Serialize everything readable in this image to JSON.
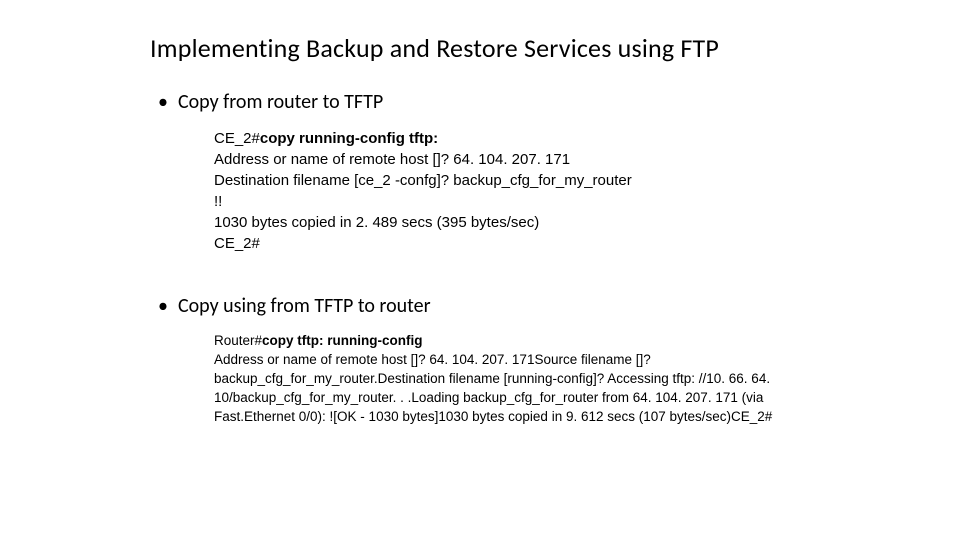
{
  "title": "Implementing Backup and Restore Services using FTP",
  "section1": {
    "heading": "Copy from router to  TFTP",
    "cmd_prefix": "CE_2#",
    "cmd": "copy running-config tftp:",
    "line2": "Address or name of remote host []? 64. 104. 207. 171",
    "line3": "Destination filename [ce_2 -confg]? backup_cfg_for_my_router",
    "line4": "!!",
    "line5": "1030 bytes copied in 2. 489 secs (395 bytes/sec)",
    "line6": "CE_2#"
  },
  "section2": {
    "heading": "Copy using from  TFTP to router",
    "cmd_prefix": "Router#",
    "cmd": "copy tftp: running-config",
    "body": "Address or name of remote host []? 64. 104. 207. 171Source filename []? backup_cfg_for_my_router.Destination filename [running-config]? Accessing tftp: //10. 66. 64. 10/backup_cfg_for_my_router. . .Loading backup_cfg_for_router from 64. 104. 207. 171 (via Fast.Ethernet 0/0): ![OK - 1030 bytes]1030 bytes copied in 9. 612 secs (107 bytes/sec)CE_2#"
  }
}
